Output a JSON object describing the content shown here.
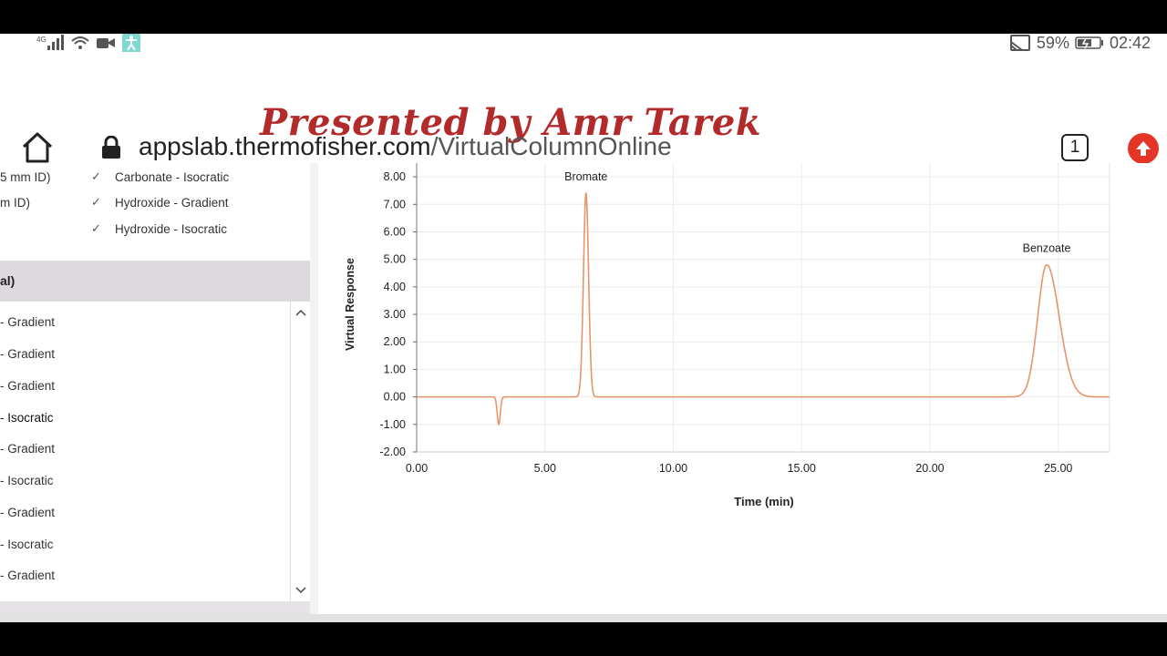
{
  "status_bar": {
    "network": "4G",
    "battery": "59%",
    "time": "02:42"
  },
  "browser": {
    "watermark": "Presented by Amr Tarek",
    "url_domain": "appslab.thermofisher.com",
    "url_path": "/VirtualColumnOnline",
    "tab_count": "1"
  },
  "left_panel": {
    "column_rows": [
      "5 mm ID)",
      "m ID)"
    ],
    "eluent_filters": [
      {
        "label": "Carbonate - Isocratic",
        "checked": true
      },
      {
        "label": "Hydroxide - Gradient",
        "checked": true
      },
      {
        "label": "Hydroxide - Isocratic",
        "checked": true
      }
    ],
    "section_header": "al)",
    "list_items": [
      {
        "label": "- Gradient",
        "selected": false
      },
      {
        "label": "- Gradient",
        "selected": false
      },
      {
        "label": "- Gradient",
        "selected": false
      },
      {
        "label": "- Isocratic",
        "selected": true
      },
      {
        "label": "- Gradient",
        "selected": false
      },
      {
        "label": "- Isocratic",
        "selected": false
      },
      {
        "label": "- Gradient",
        "selected": false
      },
      {
        "label": "- Isocratic",
        "selected": false
      },
      {
        "label": "- Gradient",
        "selected": false
      }
    ]
  },
  "chart_data": {
    "type": "line",
    "xlabel": "Time (min)",
    "ylabel": "Virtual Response",
    "xlim": [
      0,
      27
    ],
    "ylim": [
      -2,
      8.5
    ],
    "x_ticks": [
      "0.00",
      "5.00",
      "10.00",
      "15.00",
      "20.00",
      "25.00"
    ],
    "y_ticks": [
      "8.00",
      "7.00",
      "6.00",
      "5.00",
      "4.00",
      "3.00",
      "2.00",
      "1.00",
      "0.00",
      "-1.00",
      "-2.00"
    ],
    "grid": true,
    "line_color": "#e8946a",
    "series": [
      {
        "peaks": [
          {
            "name": "",
            "center": 3.2,
            "height": -1.0,
            "width": 0.06
          },
          {
            "name": "Bromate",
            "center": 6.6,
            "height": 7.4,
            "width": 0.1
          },
          {
            "name": "Benzoate",
            "center": 24.55,
            "height": 4.8,
            "width": 0.35
          }
        ]
      }
    ]
  }
}
